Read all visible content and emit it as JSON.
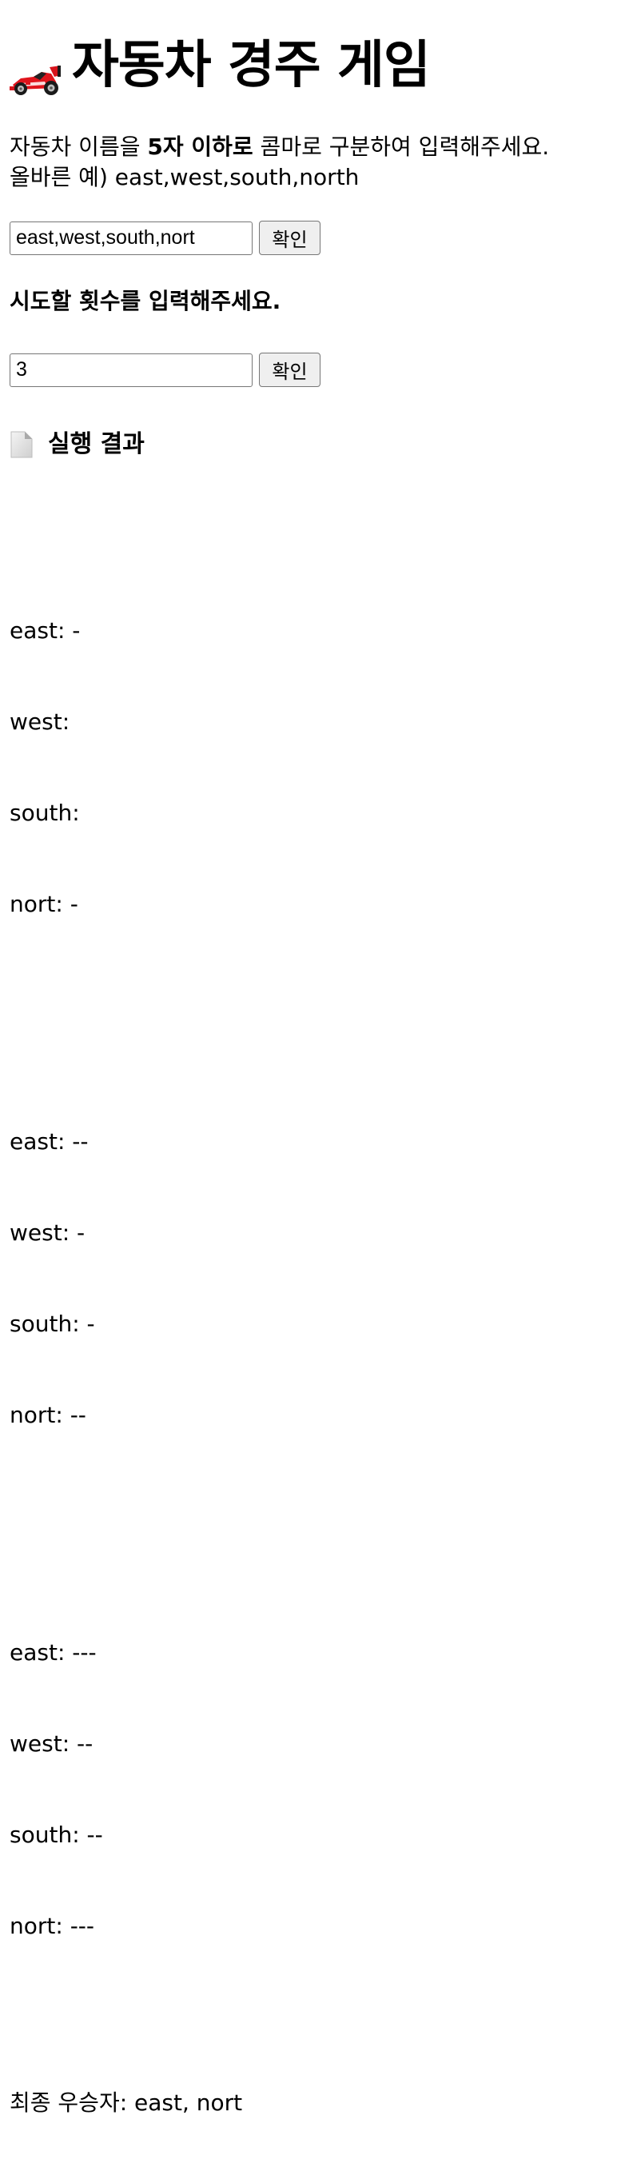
{
  "header": {
    "icon": "racing-car-icon",
    "title": "자동차 경주 게임"
  },
  "instructions": {
    "line1_before": "자동차 이름을ㅤ",
    "line1_bold": "5자 이하로",
    "line1_after": " 콤마로 구분하여 입력해주세요.",
    "line2": "올바른 예) east,west,south,north"
  },
  "car_names": {
    "value": "east,west,south,nort",
    "button_label": "확인"
  },
  "attempts": {
    "heading": "시도할 횟수를 입력해주세요.",
    "value": "3",
    "button_label": "확인"
  },
  "results": {
    "icon": "document-icon",
    "heading": "실행 결과",
    "rounds": [
      [
        "east: -",
        "west: ",
        "south: ",
        "nort: -"
      ],
      [
        "east: --",
        "west: -",
        "south: -",
        "nort: --"
      ],
      [
        "east: ---",
        "west: --",
        "south: --",
        "nort: ---"
      ]
    ],
    "winner": "최종 우승자: east, nort"
  },
  "colors": {
    "background": "#ffffff",
    "text": "#000000",
    "button_bg": "#efefef",
    "border": "#767676"
  }
}
